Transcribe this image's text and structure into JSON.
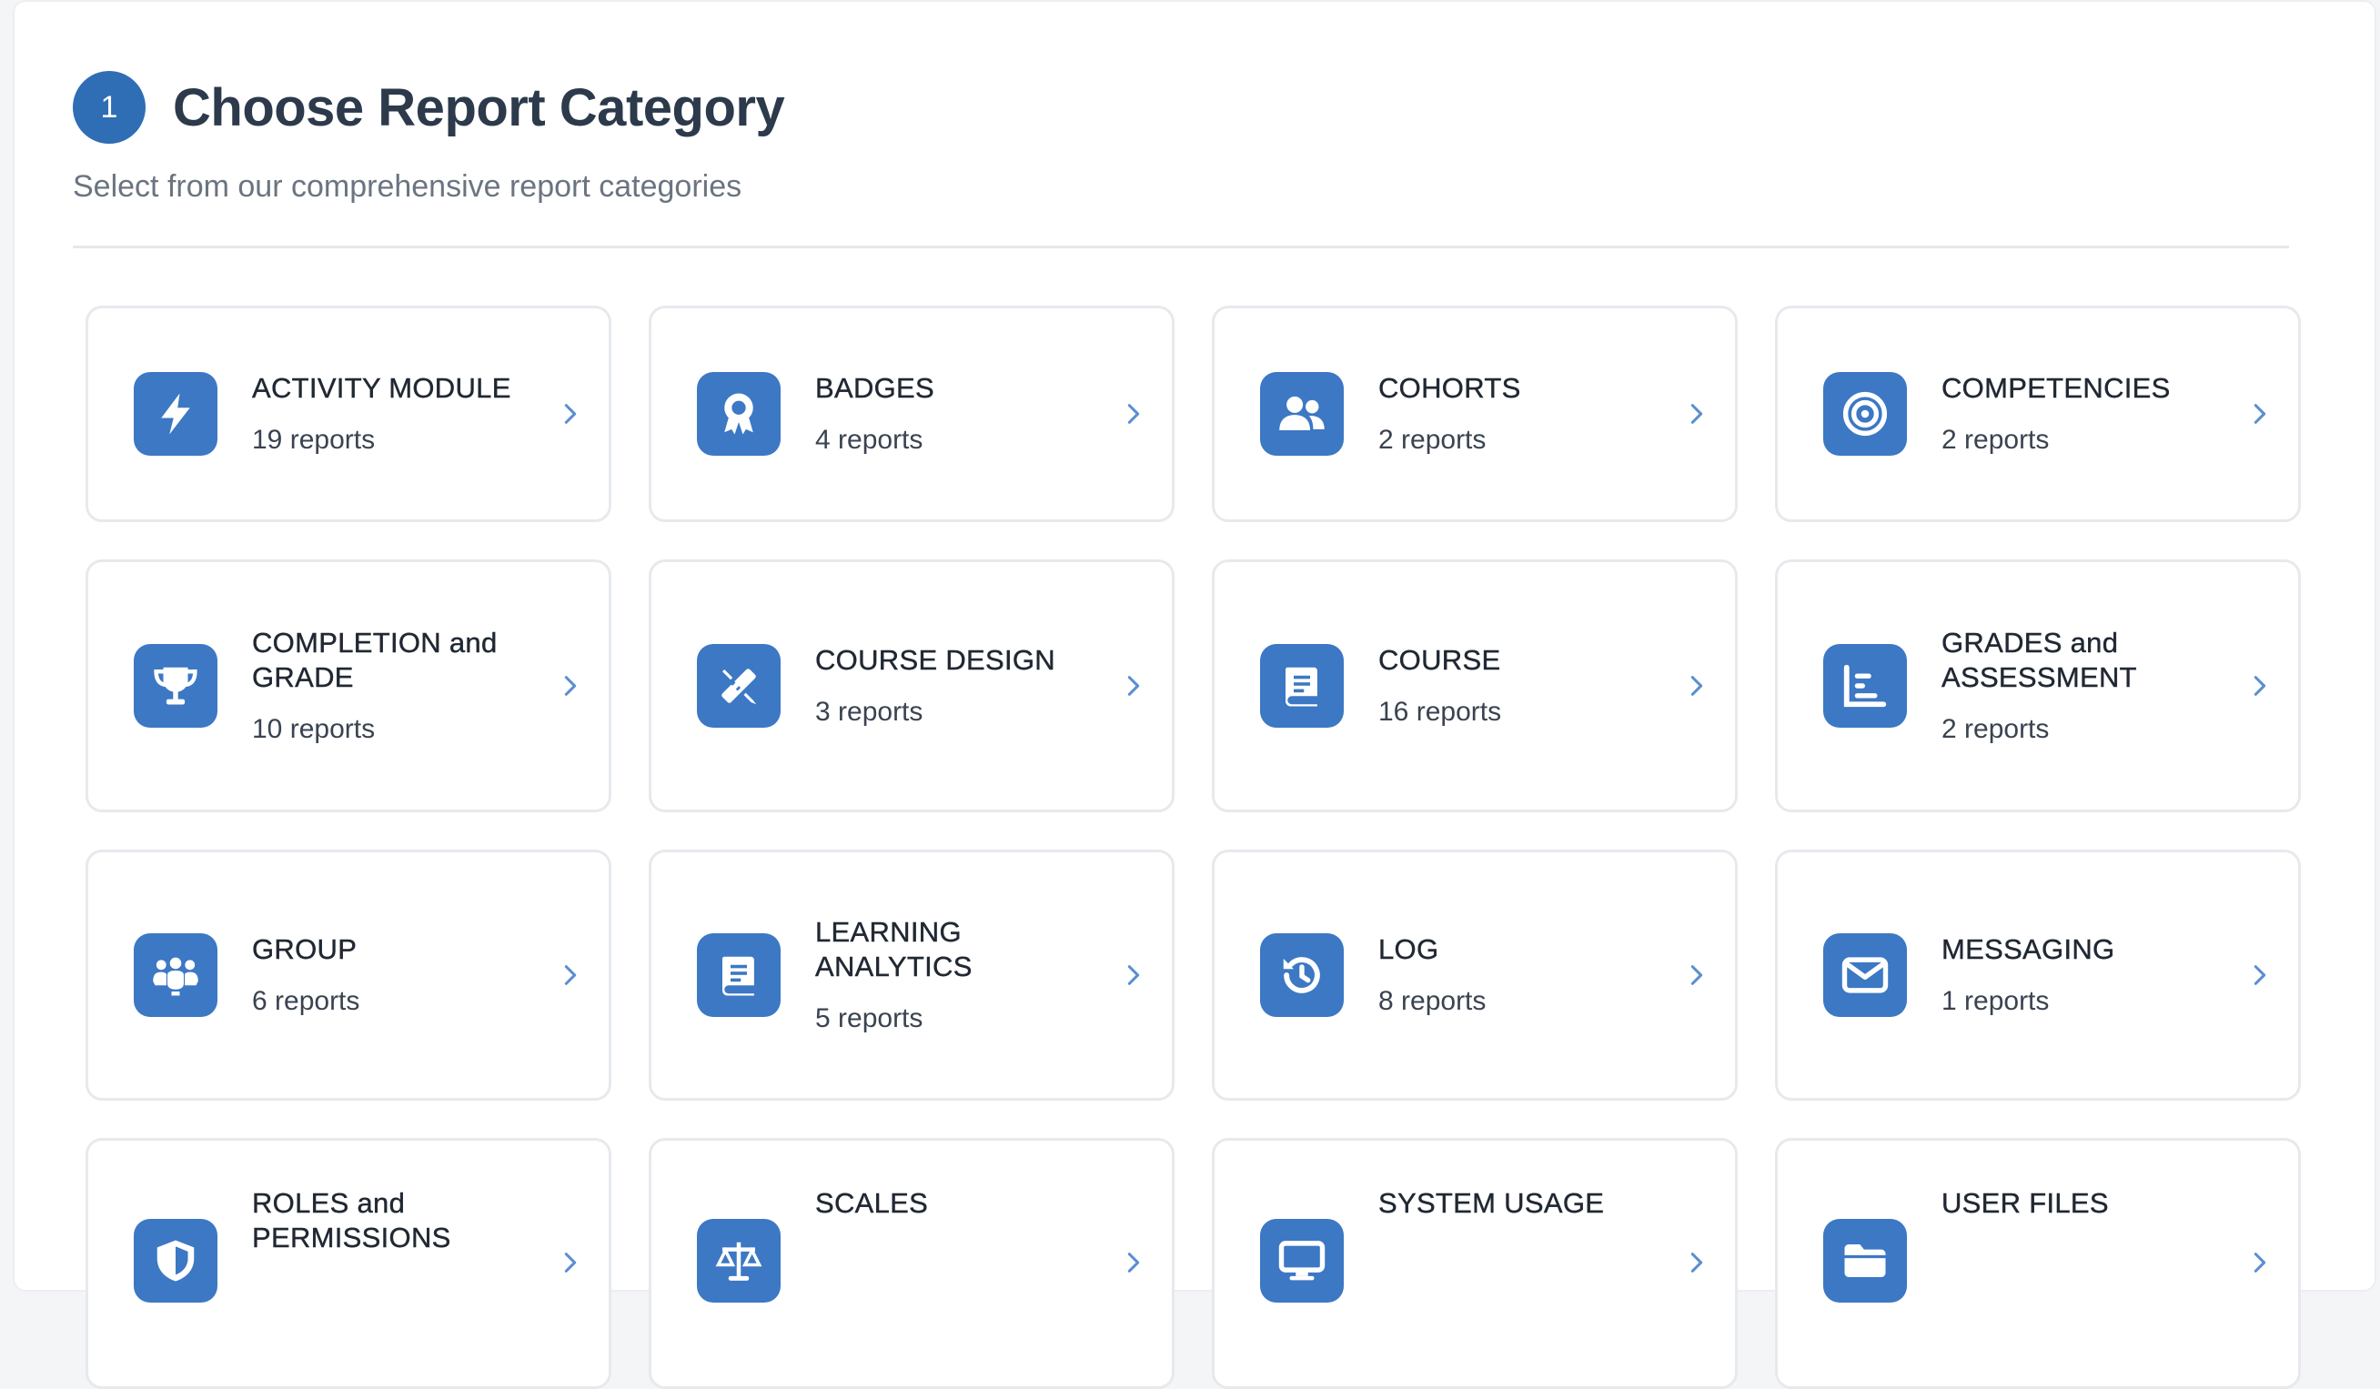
{
  "header": {
    "step_number": "1",
    "title": "Choose Report Category",
    "subtitle": "Select from our comprehensive report categories"
  },
  "categories": [
    {
      "name": "ACTIVITY MODULE",
      "count": "19 reports",
      "icon": "bolt-icon"
    },
    {
      "name": "BADGES",
      "count": "4 reports",
      "icon": "award-icon"
    },
    {
      "name": "COHORTS",
      "count": "2 reports",
      "icon": "users-icon"
    },
    {
      "name": "COMPETENCIES",
      "count": "2 reports",
      "icon": "target-icon"
    },
    {
      "name": "COMPLETION and GRADE",
      "count": "10 reports",
      "icon": "trophy-icon"
    },
    {
      "name": "COURSE DESIGN",
      "count": "3 reports",
      "icon": "pencil-ruler-icon"
    },
    {
      "name": "COURSE",
      "count": "16 reports",
      "icon": "book-icon"
    },
    {
      "name": "GRADES and ASSESSMENT",
      "count": "2 reports",
      "icon": "chart-icon"
    },
    {
      "name": "GROUP",
      "count": "6 reports",
      "icon": "group-icon"
    },
    {
      "name": "LEARNING ANALYTICS",
      "count": "5 reports",
      "icon": "book-icon"
    },
    {
      "name": "LOG",
      "count": "8 reports",
      "icon": "history-icon"
    },
    {
      "name": "MESSAGING",
      "count": "1 reports",
      "icon": "envelope-icon"
    },
    {
      "name": "ROLES and PERMISSIONS",
      "count": "",
      "icon": "shield-icon"
    },
    {
      "name": "SCALES",
      "count": "",
      "icon": "scale-icon"
    },
    {
      "name": "SYSTEM USAGE",
      "count": "",
      "icon": "monitor-icon"
    },
    {
      "name": "USER FILES",
      "count": "",
      "icon": "folder-icon"
    }
  ],
  "colors": {
    "accent": "#3c78c4",
    "chevron": "#5b8fd0"
  }
}
